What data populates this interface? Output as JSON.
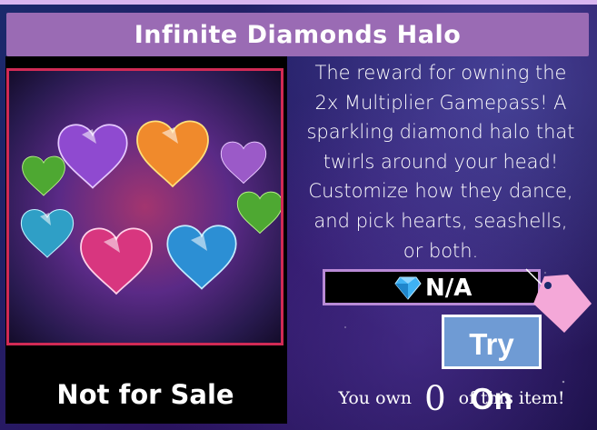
{
  "title": "Infinite Diamonds Halo",
  "image": {
    "alt_icon": "diamond-hearts-halo-image",
    "frame_color": "#d12a55"
  },
  "sale_status": "Not for Sale",
  "description": "The reward for owning the 2x Multiplier Gamepass! A sparkling diamond halo that twirls around your head! Customize how they dance, and pick hearts, seashells, or both.",
  "price": {
    "icon": "diamond-icon",
    "value": "N/A"
  },
  "tag_icon": "price-tag-icon",
  "try_on_label": "Try On",
  "ownership": {
    "prefix": "You own",
    "count": "0",
    "suffix": "of this item!"
  },
  "colors": {
    "title_bar": "#9a6bb4",
    "try_on_button": "#6f9bd4",
    "price_border": "#b98ad6",
    "tag": "#f4a8d8"
  }
}
